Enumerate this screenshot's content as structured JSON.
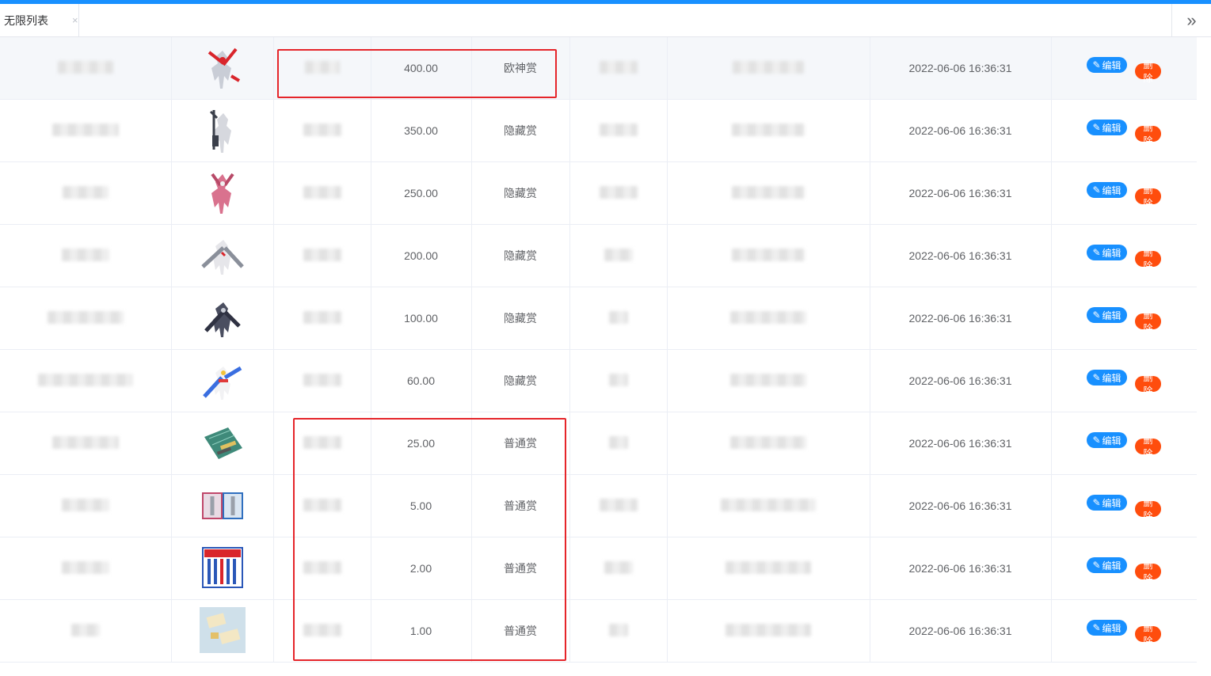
{
  "tabbar": {
    "tab_label": "无限列表",
    "tab_close": "×",
    "more_glyph": "»"
  },
  "actions": {
    "edit_label": "编辑",
    "delete_label": "删除",
    "edit_icon_glyph": "✎"
  },
  "colors": {
    "accent": "#1890ff",
    "danger": "#ff4d0d",
    "highlight_box": "#e5252a"
  },
  "rows": [
    {
      "price": "400.00",
      "tier": "欧神赏",
      "time": "2022-06-06 16:36:31",
      "image": "red-gundam-figure"
    },
    {
      "price": "350.00",
      "tier": "隐藏赏",
      "time": "2022-06-06 16:36:31",
      "image": "white-armored-gundam"
    },
    {
      "price": "250.00",
      "tier": "隐藏赏",
      "time": "2022-06-06 16:36:31",
      "image": "pink-gundam-figure"
    },
    {
      "price": "200.00",
      "tier": "隐藏赏",
      "time": "2022-06-06 16:36:31",
      "image": "winged-gundam-figure"
    },
    {
      "price": "100.00",
      "tier": "隐藏赏",
      "time": "2022-06-06 16:36:31",
      "image": "dark-gundam-figure"
    },
    {
      "price": "60.00",
      "tier": "隐藏赏",
      "time": "2022-06-06 16:36:31",
      "image": "wing-gundam-figure"
    },
    {
      "price": "25.00",
      "tier": "普通赏",
      "time": "2022-06-06 16:36:31",
      "image": "cutting-mat-tools"
    },
    {
      "price": "5.00",
      "tier": "普通赏",
      "time": "2022-06-06 16:36:31",
      "image": "model-kit-boxes"
    },
    {
      "price": "2.00",
      "tier": "普通赏",
      "time": "2022-06-06 16:36:31",
      "image": "marker-pen-set"
    },
    {
      "price": "1.00",
      "tier": "普通赏",
      "time": "2022-06-06 16:36:31",
      "image": "sanding-blocks"
    }
  ]
}
